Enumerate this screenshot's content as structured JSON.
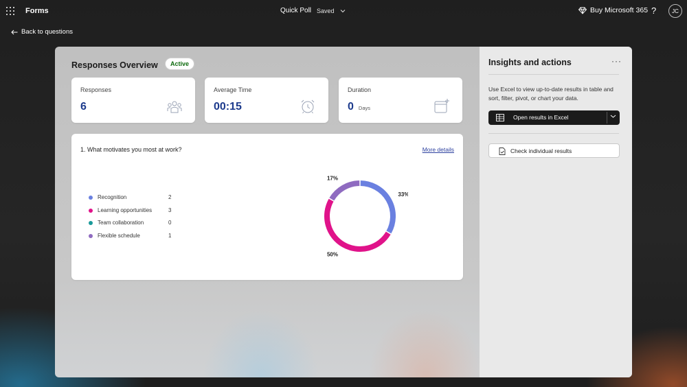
{
  "topbar": {
    "app_name": "Forms",
    "form_title": "Quick Poll",
    "save_status": "Saved",
    "buy_label": "Buy Microsoft 365",
    "help_label": "?",
    "avatar_initials": "JC"
  },
  "nav": {
    "back_label": "Back to questions"
  },
  "overview": {
    "title": "Responses Overview",
    "status_badge": "Active",
    "stats": [
      {
        "label": "Responses",
        "value": "6",
        "icon": "people-icon"
      },
      {
        "label": "Average Time",
        "value": "00:15",
        "icon": "alarm-clock-icon"
      },
      {
        "label": "Duration",
        "value": "0",
        "unit": "Days",
        "icon": "calendar-add-icon"
      }
    ]
  },
  "question": {
    "title": "1. What motivates you most at work?",
    "more_details": "More details",
    "options": [
      {
        "name": "Recognition",
        "count": "2",
        "color": "#6a80e0"
      },
      {
        "name": "Learning opportunities",
        "count": "3",
        "color": "#e0138a"
      },
      {
        "name": "Team collaboration",
        "count": "0",
        "color": "#1a9a9a"
      },
      {
        "name": "Flexible schedule",
        "count": "1",
        "color": "#8f6bc0"
      }
    ]
  },
  "chart_data": {
    "type": "pie",
    "categories": [
      "Recognition",
      "Learning opportunities",
      "Team collaboration",
      "Flexible schedule"
    ],
    "values": [
      2,
      3,
      0,
      1
    ],
    "percent_labels": [
      "33%",
      "50%",
      "17%"
    ],
    "colors": [
      "#6a80e0",
      "#e0138a",
      "#1a9a9a",
      "#8f6bc0"
    ],
    "donut": true,
    "legend": "left"
  },
  "panel": {
    "title": "Insights and actions",
    "more_label": "···",
    "description": "Use Excel to view up-to-date results in table and sort, filter, pivot, or chart your data.",
    "excel_button": "Open results in Excel",
    "check_button": "Check individual results"
  }
}
